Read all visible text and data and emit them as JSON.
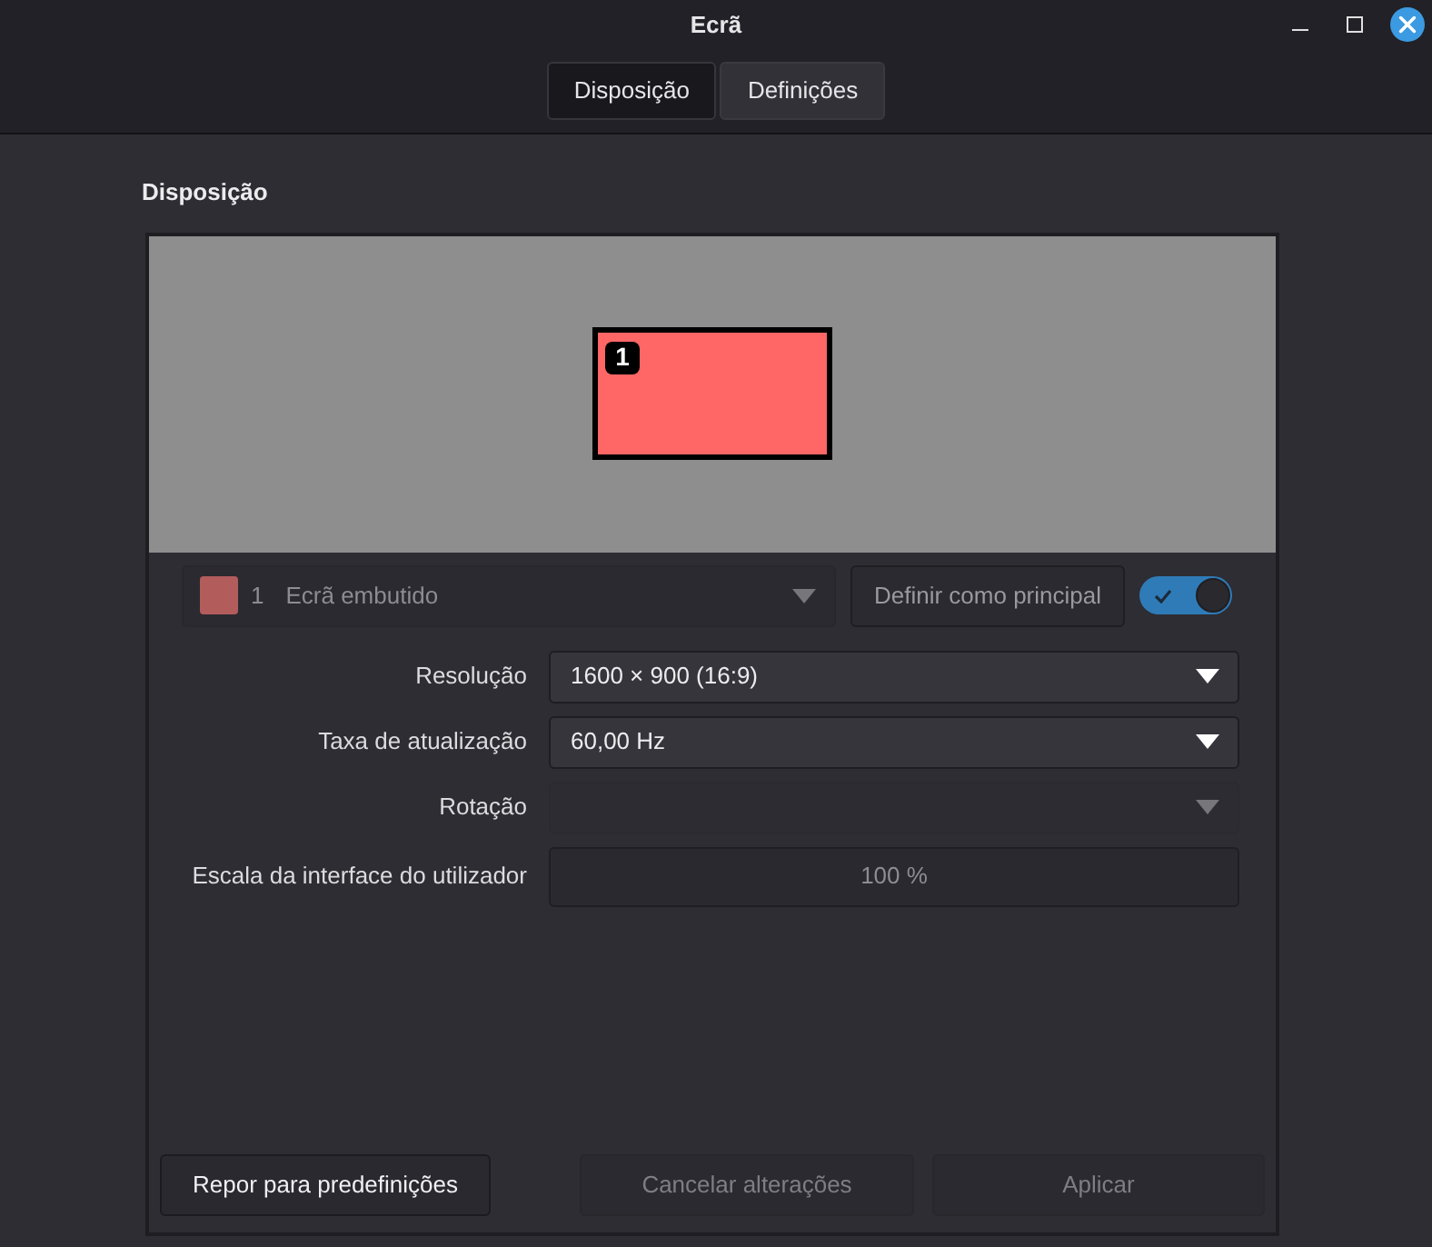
{
  "window": {
    "title": "Ecrã"
  },
  "tabs": [
    {
      "label": "Disposição",
      "selected": true
    },
    {
      "label": "Definições",
      "selected": false
    }
  ],
  "section_title": "Disposição",
  "layout_preview": {
    "monitors": [
      {
        "number": "1",
        "color": "#ff6666"
      }
    ]
  },
  "display_selector": {
    "number": "1",
    "name": "Ecrã embutido",
    "color": "#b35c5c",
    "disabled": true
  },
  "primary_button": {
    "label": "Definir como principal",
    "disabled": true
  },
  "output_switch": {
    "on": true
  },
  "settings": [
    {
      "kind": "dropdown",
      "label": "Resolução",
      "value": "1600 × 900 (16:9)",
      "disabled": false
    },
    {
      "kind": "dropdown",
      "label": "Taxa de atualização",
      "value": "60,00 Hz",
      "disabled": false
    },
    {
      "kind": "dropdown",
      "label": "Rotação",
      "disabled": true
    },
    {
      "kind": "scale",
      "label": "Escala da interface do utilizador",
      "value": "100 %",
      "disabled": true
    }
  ],
  "buttons": [
    {
      "label": "Repor para predefinições",
      "disabled": false
    },
    {
      "label": "Cancelar alterações",
      "disabled": true
    },
    {
      "label": "Aplicar",
      "disabled": true
    }
  ]
}
